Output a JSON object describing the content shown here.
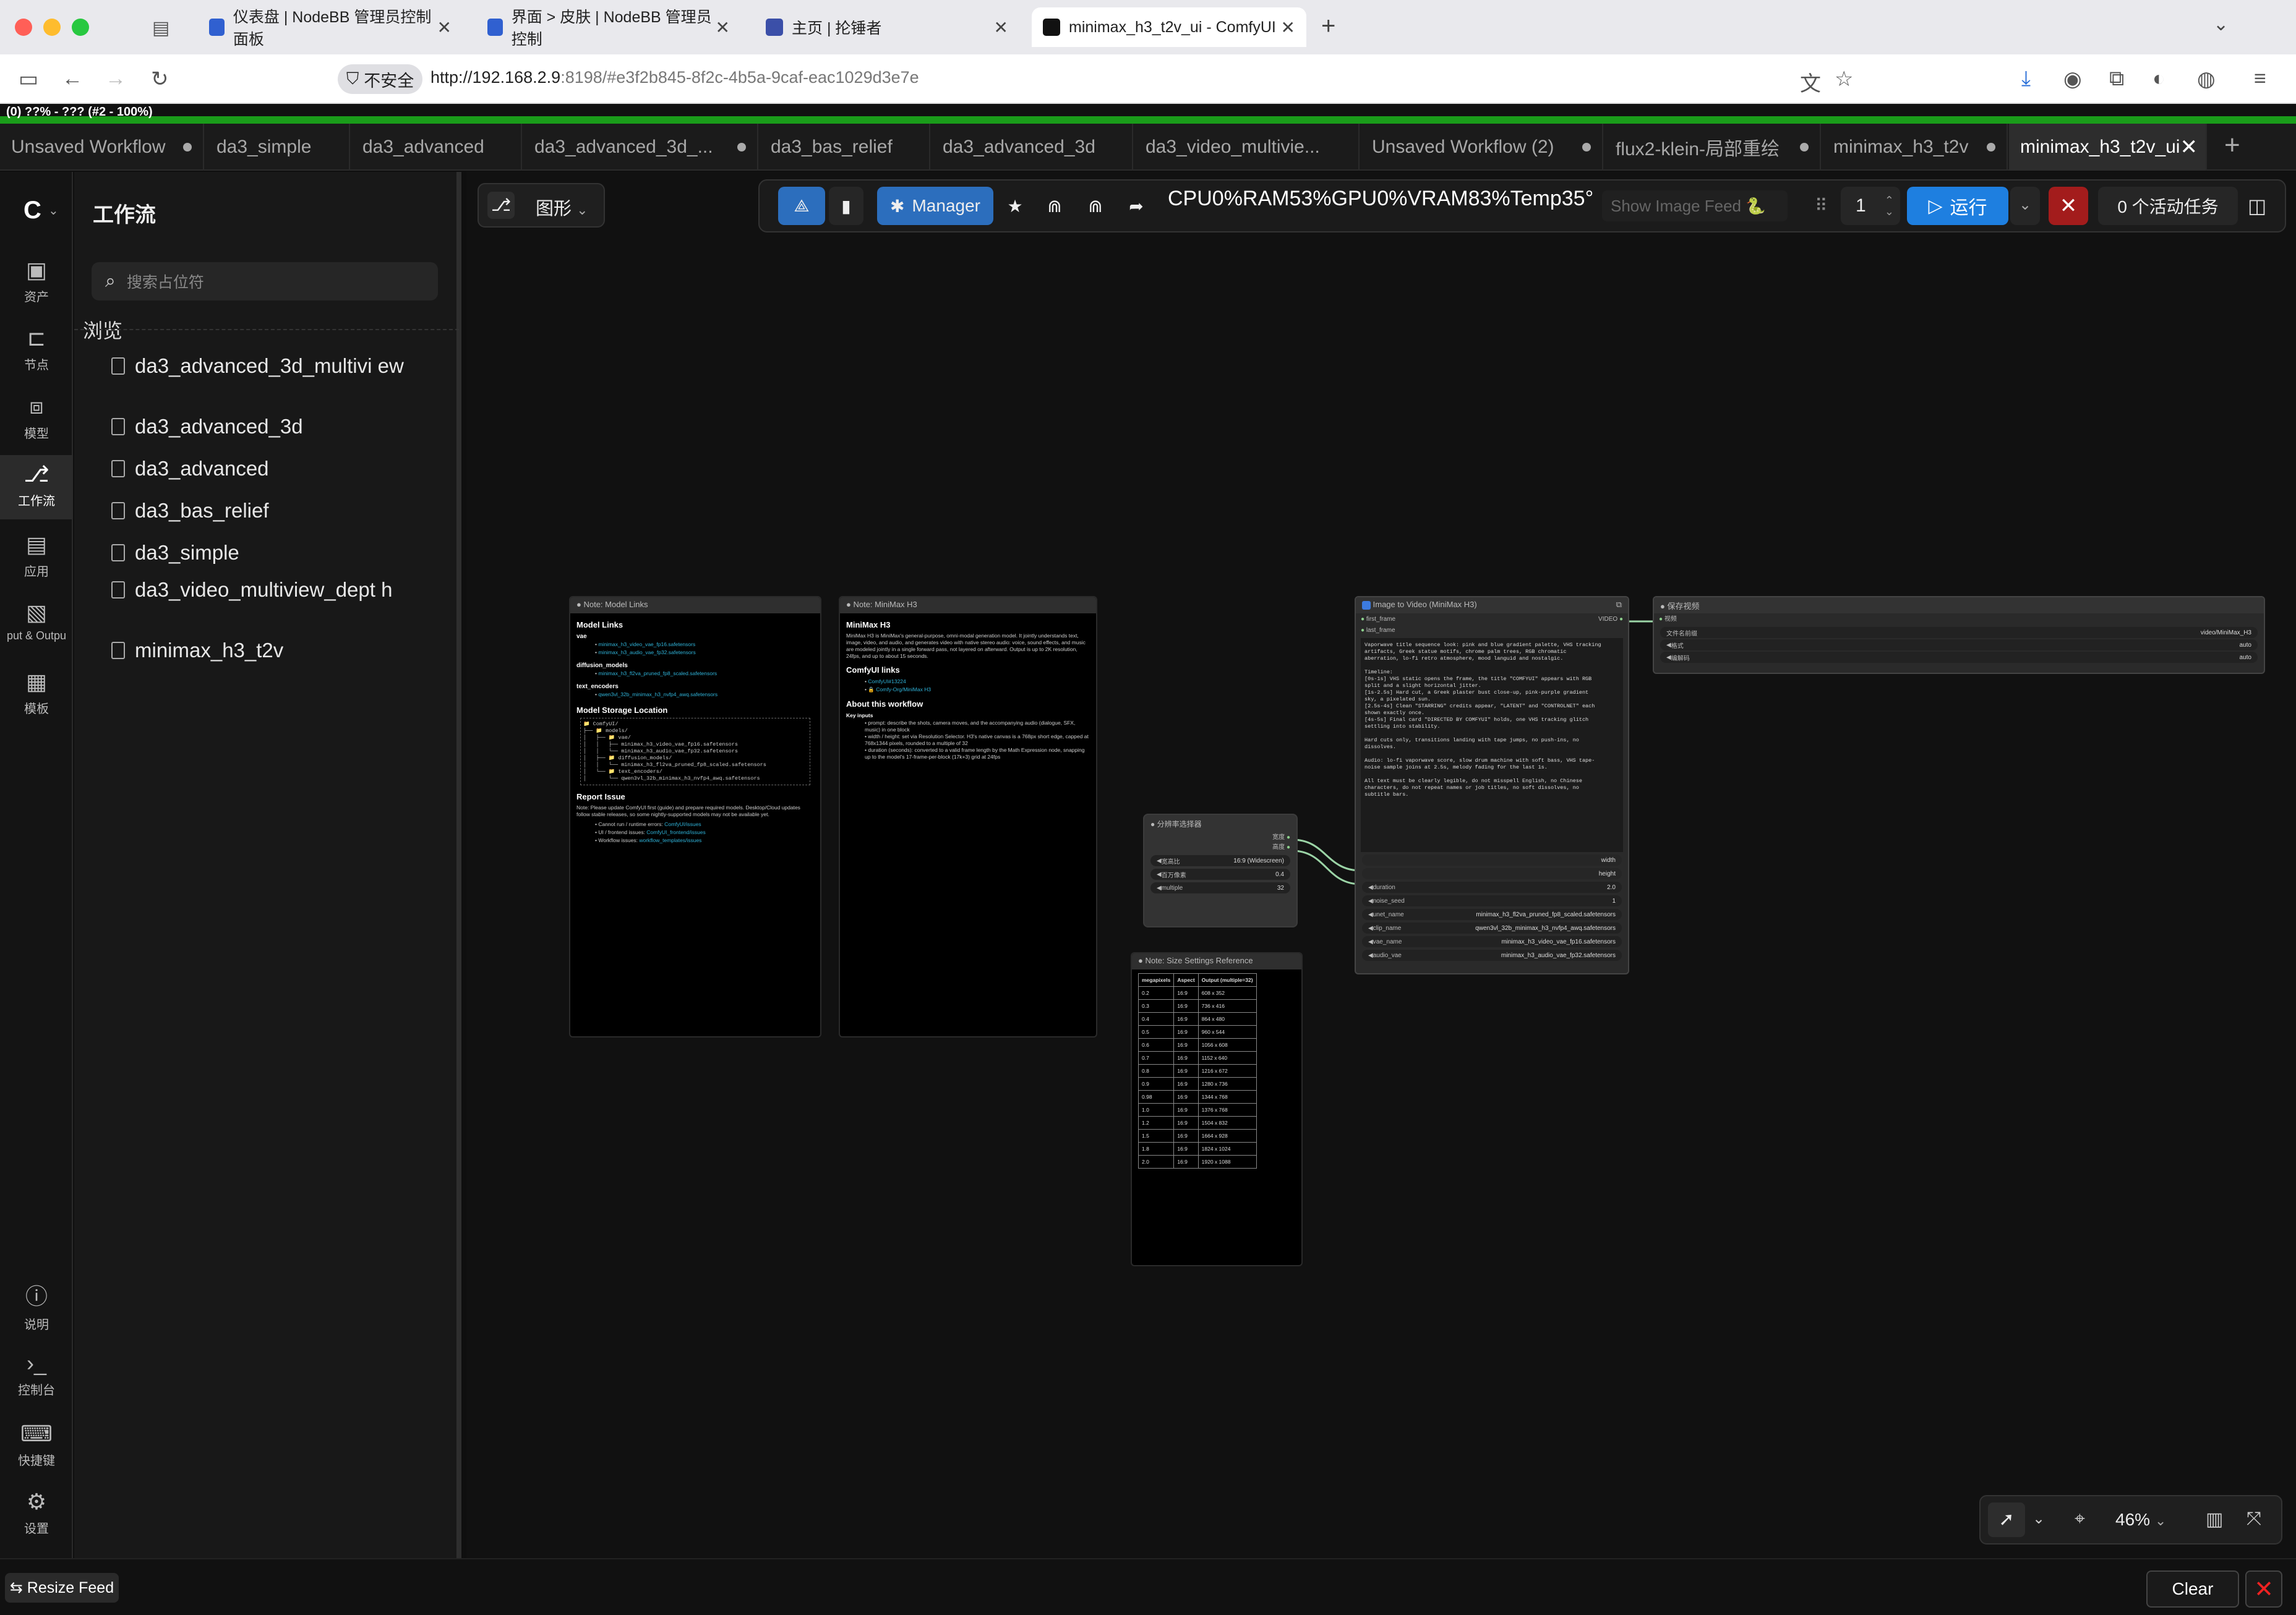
{
  "browser": {
    "tabs": [
      {
        "label": "仪表盘 | NodeBB 管理员控制面板"
      },
      {
        "label": "界面 > 皮肤 | NodeBB 管理员控制"
      },
      {
        "label": "主页 | 抡锤者"
      },
      {
        "label": "minimax_h3_t2v_ui - ComfyUI"
      }
    ],
    "security_label": "不安全",
    "url_host": "http://192.168.2.9",
    "url_rest": ":8198/#e3f2b845-8f2c-4b5a-9caf-eac1029d3e7e",
    "progress_text": "(0) ??% - ??? (#2 - 100%)"
  },
  "workflow_tabs": [
    {
      "label": "Unsaved Workflow",
      "unsaved": true
    },
    {
      "label": "da3_simple",
      "unsaved": false
    },
    {
      "label": "da3_advanced",
      "unsaved": false
    },
    {
      "label": "da3_advanced_3d_...",
      "unsaved": true
    },
    {
      "label": "da3_bas_relief",
      "unsaved": false
    },
    {
      "label": "da3_advanced_3d",
      "unsaved": false
    },
    {
      "label": "da3_video_multivie...",
      "unsaved": false
    },
    {
      "label": "Unsaved Workflow (2)",
      "unsaved": true
    },
    {
      "label": "flux2-klein-局部重绘",
      "unsaved": true
    },
    {
      "label": "minimax_h3_t2v",
      "unsaved": true
    },
    {
      "label": "minimax_h3_t2v_ui",
      "unsaved": false
    }
  ],
  "rail": {
    "items": [
      {
        "label": "资产",
        "icon": "image-icon"
      },
      {
        "label": "节点",
        "icon": "node-icon"
      },
      {
        "label": "模型",
        "icon": "model-icon"
      },
      {
        "label": "工作流",
        "icon": "workflow-icon"
      },
      {
        "label": "应用",
        "icon": "app-icon"
      },
      {
        "label": "put & Outpu",
        "icon": "media-icon"
      },
      {
        "label": "模板",
        "icon": "template-icon"
      }
    ],
    "bottom": [
      {
        "label": "说明",
        "icon": "help-icon"
      },
      {
        "label": "控制台",
        "icon": "terminal-icon"
      },
      {
        "label": "快捷键",
        "icon": "keyboard-icon"
      },
      {
        "label": "设置",
        "icon": "gear-icon"
      }
    ]
  },
  "workflow_panel": {
    "title": "工作流",
    "search_placeholder": "搜索占位符",
    "section": "浏览",
    "items": [
      "da3_advanced_3d_multivi ew",
      "da3_advanced_3d",
      "da3_advanced",
      "da3_bas_relief",
      "da3_simple",
      "da3_video_multiview_dept h",
      "minimax_h3_t2v"
    ]
  },
  "toolbar": {
    "graph_label": "图形",
    "manager_label": "Manager",
    "stats": "CPU0%RAM53%GPU0%VRAM83%Temp35°",
    "image_feed": "Show Image Feed 🐍",
    "batch_count": "1",
    "run_label": "运行",
    "tasks_label": "0 个活动任务"
  },
  "nodes": {
    "model_links": {
      "title": "Note: Model Links",
      "heading": "Model Links",
      "vae": "vae",
      "vae_files": [
        "minimax_h3_video_vae_fp16.safetensors",
        "minimax_h3_audio_vae_fp32.safetensors"
      ],
      "diffusion": "diffusion_models",
      "diffusion_files": [
        "minimax_h3_fl2va_pruned_fp8_scaled.safetensors"
      ],
      "text_enc": "text_encoders",
      "text_enc_files": [
        "qwen3vl_32b_minimax_h3_nvfp4_awq.safetensors"
      ],
      "storage_heading": "Model Storage Location",
      "storage_tree": "📁 ComfyUI/\n├── 📁 models/\n│   ├── 📁 vae/\n│   │   ├── minimax_h3_video_vae_fp16.safetensors\n│   │   └── minimax_h3_audio_vae_fp32.safetensors\n│   ├── 📁 diffusion_models/\n│   │   └── minimax_h3_fl2va_pruned_fp8_scaled.safetensors\n│   └── 📁 text_encoders/\n│       └── qwen3vl_32b_minimax_h3_nvfp4_awq.safetensors",
      "report_heading": "Report Issue",
      "report_text": "Note: Please update ComfyUI first (guide) and prepare required models. Desktop/Cloud updates follow stable releases, so some nightly-supported models may not be available yet.",
      "report_items": [
        {
          "k": "Cannot run / runtime errors: ",
          "v": "ComfyUI/issues"
        },
        {
          "k": "UI / frontend issues: ",
          "v": "ComfyUI_frontend/issues"
        },
        {
          "k": "Workflow issues: ",
          "v": "workflow_templates/issues"
        }
      ]
    },
    "minimax_note": {
      "title": "Note: MiniMax H3",
      "heading": "MiniMax H3",
      "intro": "MiniMax H3 is MiniMax's general-purpose, omni-modal generation model. It jointly understands text, image, video, and audio, and generates video with native stereo audio: voice, sound effects, and music are modeled jointly in a single forward pass, not layered on afterward. Output is up to 2K resolution, 24fps, and up to about 15 seconds.",
      "links_heading": "ComfyUI links",
      "links": [
        "ComfyUI#13224",
        "🔒 Comfy-Org/MiniMax H3"
      ],
      "about_heading": "About this workflow",
      "key_inputs": "Key inputs",
      "inputs": [
        "prompt: describe the shots, camera moves, and the accompanying audio (dialogue, SFX, music) in one block",
        "width / height: set via Resolution Selector. H3's native canvas is a 768px short edge, capped at 768x1344 pixels, rounded to a multiple of 32",
        "duration (seconds): converted to a valid frame length by the Math Expression node, snapping up to the model's 17-frame-per-block (17k+3) grid at 24fps"
      ]
    },
    "resolution": {
      "title": "分辨率选择器",
      "out1": "宽度",
      "out2": "高度",
      "rows": [
        {
          "k": "宽高比",
          "v": "16:9 (Widescreen)"
        },
        {
          "k": "百万像素",
          "v": "0.4"
        },
        {
          "k": "multiple",
          "v": "32"
        }
      ]
    },
    "size_ref": {
      "title": "Note: Size Settings Reference",
      "headers": [
        "megapixels",
        "Aspect",
        "Output (multiple=32)"
      ],
      "rows": [
        [
          "0.2",
          "16:9",
          "608 x 352"
        ],
        [
          "0.3",
          "16:9",
          "736 x 416"
        ],
        [
          "0.4",
          "16:9",
          "864 x 480"
        ],
        [
          "0.5",
          "16:9",
          "960 x 544"
        ],
        [
          "0.6",
          "16:9",
          "1056 x 608"
        ],
        [
          "0.7",
          "16:9",
          "1152 x 640"
        ],
        [
          "0.8",
          "16:9",
          "1216 x 672"
        ],
        [
          "0.9",
          "16:9",
          "1280 x 736"
        ],
        [
          "0.98",
          "16:9",
          "1344 x 768"
        ],
        [
          "1.0",
          "16:9",
          "1376 x 768"
        ],
        [
          "1.2",
          "16:9",
          "1504 x 832"
        ],
        [
          "1.5",
          "16:9",
          "1664 x 928"
        ],
        [
          "1.8",
          "16:9",
          "1824 x 1024"
        ],
        [
          "2.0",
          "16:9",
          "1920 x 1088"
        ]
      ]
    },
    "i2v": {
      "title": "Image to Video (MiniMax H3)",
      "in1": "first_frame",
      "in2": "last_frame",
      "out": "VIDEO",
      "prompt": "Vaporwave title sequence look: pink and blue gradient palette, VHS tracking\nartifacts, Greek statue motifs, chrome palm trees, RGB chromatic\naberration, lo-fi retro atmosphere, mood languid and nostalgic.\n\nTimeline:\n[0s-1s] VHS static opens the frame, the title \"COMFYUI\" appears with RGB\nsplit and a slight horizontal jitter.\n[1s-2.5s] Hard cut, a Greek plaster bust close-up, pink-purple gradient\nsky, a pixelated sun.\n[2.5s-4s] Clean \"STARRING\" credits appear, \"LATENT\" and \"CONTROLNET\" each\nshown exactly once.\n[4s-5s] Final card \"DIRECTED BY COMFYUI\" holds, one VHS tracking glitch\nsettling into stability.\n\nHard cuts only, transitions landing with tape jumps, no push-ins, no\ndissolves.\n\nAudio: lo-fi vaporwave score, slow drum machine with soft bass, VHS tape-\nnoise sample joins at 2.5s, melody fading for the last 1s.\n\nAll text must be clearly legible, do not misspell English, no Chinese\ncharacters, do not repeat names or job titles, no soft dissolves, no\nsubtitle bars.",
      "faded": [
        "width",
        "height"
      ],
      "widgets": [
        {
          "k": "duration",
          "v": "2.0"
        },
        {
          "k": "noise_seed",
          "v": "1"
        },
        {
          "k": "unet_name",
          "v": "minimax_h3_fl2va_pruned_fp8_scaled.safetensors"
        },
        {
          "k": "clip_name",
          "v": "qwen3vl_32b_minimax_h3_nvfp4_awq.safetensors"
        },
        {
          "k": "vae_name",
          "v": "minimax_h3_video_vae_fp16.safetensors"
        },
        {
          "k": "audio_vae",
          "v": "minimax_h3_audio_vae_fp32.safetensors"
        }
      ]
    },
    "save_video": {
      "title": "保存视频",
      "in": "视频",
      "rows": [
        {
          "k": "文件名前缀",
          "v": "video/MiniMax_H3"
        },
        {
          "k": "格式",
          "v": "auto"
        },
        {
          "k": "编解码",
          "v": "auto"
        }
      ]
    }
  },
  "zoom": {
    "level": "46%"
  },
  "bottom": {
    "resize_label": "⇆ Resize Feed",
    "clear_label": "Clear"
  },
  "colors": {
    "accent": "#1e7fe0",
    "progress": "#1a9c1a",
    "danger": "#a31c1c",
    "link": "#2fb3d9"
  }
}
